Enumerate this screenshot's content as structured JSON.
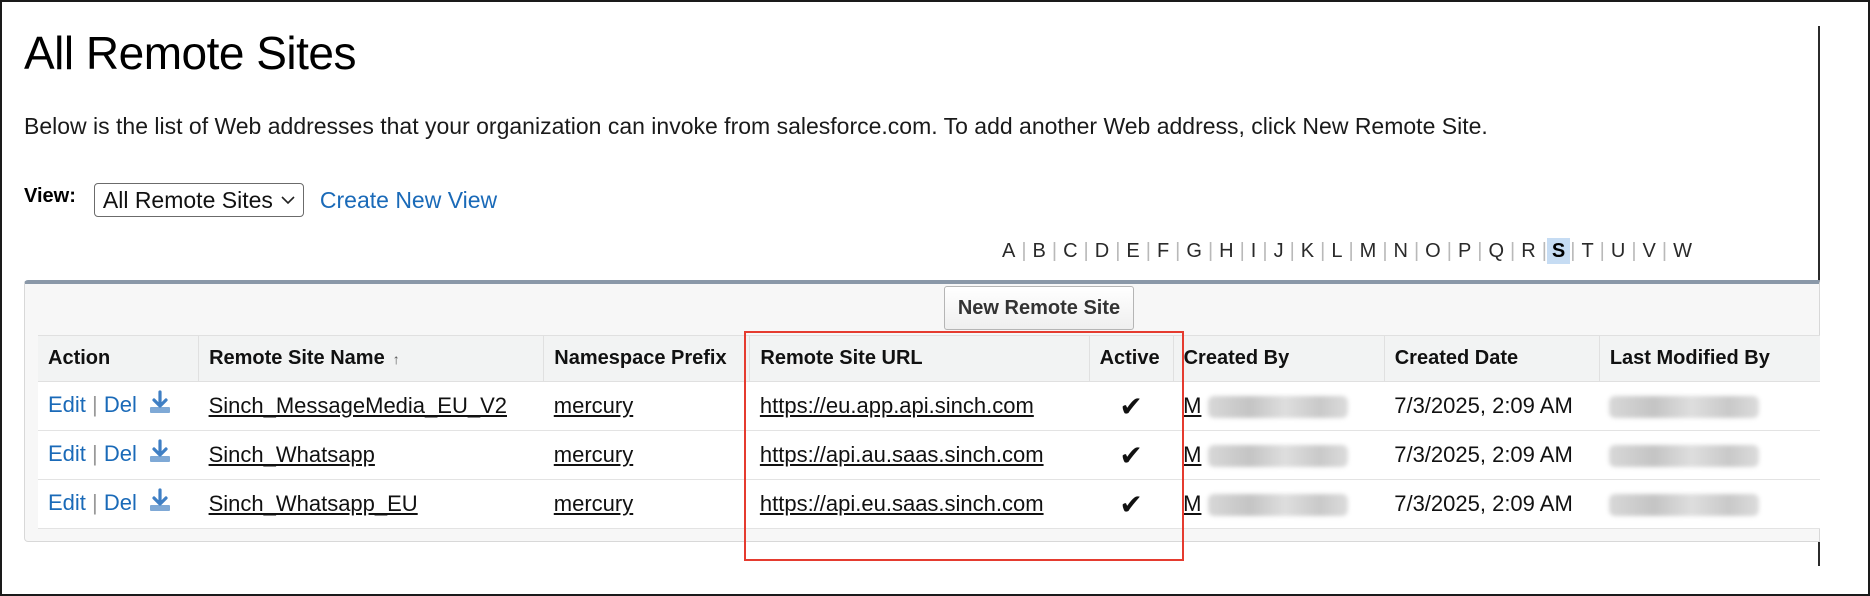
{
  "page": {
    "title": "All Remote Sites",
    "description": "Below is the list of Web addresses that your organization can invoke from salesforce.com. To add another Web address, click New Remote Site."
  },
  "view": {
    "label": "View:",
    "selected": "All Remote Sites",
    "create_link": "Create New View"
  },
  "alphabet": {
    "letters": [
      "A",
      "B",
      "C",
      "D",
      "E",
      "F",
      "G",
      "H",
      "I",
      "J",
      "K",
      "L",
      "M",
      "N",
      "O",
      "P",
      "Q",
      "R",
      "S",
      "T",
      "U",
      "V",
      "W"
    ],
    "active": "S"
  },
  "toolbar": {
    "new_button": "New Remote Site"
  },
  "table": {
    "columns": {
      "action": "Action",
      "name": "Remote Site Name",
      "name_sort": "↑",
      "namespace": "Namespace Prefix",
      "url": "Remote Site URL",
      "active": "Active",
      "created_by": "Created By",
      "created_date": "Created Date",
      "last_modified_by": "Last Modified By"
    },
    "actions": {
      "edit": "Edit",
      "sep": "|",
      "del": "Del"
    },
    "rows": [
      {
        "name": "Sinch_MessageMedia_EU_V2",
        "namespace": "mercury",
        "url": "https://eu.app.api.sinch.com",
        "active": "✔",
        "created_by_initial": "M",
        "created_date": "7/3/2025, 2:09 AM"
      },
      {
        "name": "Sinch_Whatsapp",
        "namespace": "mercury",
        "url": "https://api.au.saas.sinch.com",
        "active": "✔",
        "created_by_initial": "M",
        "created_date": "7/3/2025, 2:09 AM"
      },
      {
        "name": "Sinch_Whatsapp_EU",
        "namespace": "mercury",
        "url": "https://api.eu.saas.sinch.com",
        "active": "✔",
        "created_by_initial": "M",
        "created_date": "7/3/2025, 2:09 AM"
      }
    ]
  },
  "colors": {
    "link": "#1a6ab8",
    "highlight": "#e53b2f",
    "active_letter_bg": "#c6dcf3"
  },
  "icons": {
    "download": "download-icon",
    "select_chevron": "chevron-down-icon",
    "checkmark": "checkmark-icon"
  }
}
